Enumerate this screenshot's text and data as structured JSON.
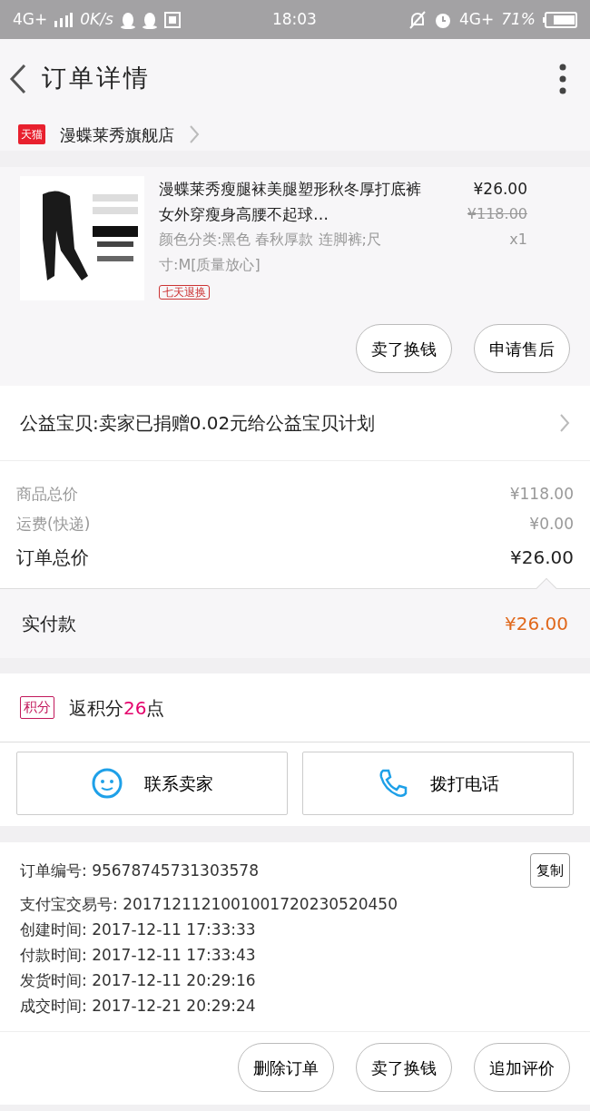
{
  "status_bar": {
    "network": "4G+",
    "speed": "0K/s",
    "time": "18:03",
    "network_right": "4G+",
    "battery": "71%"
  },
  "header": {
    "title": "订单详情"
  },
  "shop": {
    "badge": "天猫",
    "name": "漫蝶莱秀旗舰店"
  },
  "product": {
    "kind": "picture",
    "title": "漫蝶莱秀瘦腿袜美腿塑形秋冬厚打底裤女外穿瘦身高腰不起球…",
    "sku": "颜色分类:黑色 春秋厚款 连脚裤;尺寸:M[质量放心]",
    "tag": "七天退换",
    "price": "¥26.00",
    "original_price": "¥118.00",
    "quantity": "x1",
    "actions": [
      "卖了换钱",
      "申请售后"
    ]
  },
  "donation": {
    "text": "公益宝贝:卖家已捐赠0.02元给公益宝贝计划"
  },
  "summary": [
    {
      "label": "商品总价",
      "value": "¥118.00",
      "kind": "minor"
    },
    {
      "label": "运费(快递)",
      "value": "¥0.00",
      "kind": "minor"
    },
    {
      "label": "订单总价",
      "value": "¥26.00",
      "kind": "major"
    }
  ],
  "paid": {
    "label": "实付款",
    "value": "¥26.00"
  },
  "points": {
    "badge": "积分",
    "text": "返积分**26**点"
  },
  "contact": [
    {
      "label": "联系卖家",
      "kind": "chat"
    },
    {
      "label": "拨打电话",
      "kind": "phone"
    }
  ],
  "info": {
    "order_no": "订单编号: 95678745731303578",
    "copy": "复制",
    "lines": [
      "支付宝交易号: 2017121121001001720230520450",
      "创建时间: 2017-12-11 17:33:33",
      "付款时间: 2017-12-11 17:33:43",
      "发货时间: 2017-12-11 20:29:16",
      "成交时间: 2017-12-21 20:29:24"
    ]
  },
  "bottom_buttons": [
    "删除订单",
    "卖了换钱",
    "追加评价"
  ]
}
